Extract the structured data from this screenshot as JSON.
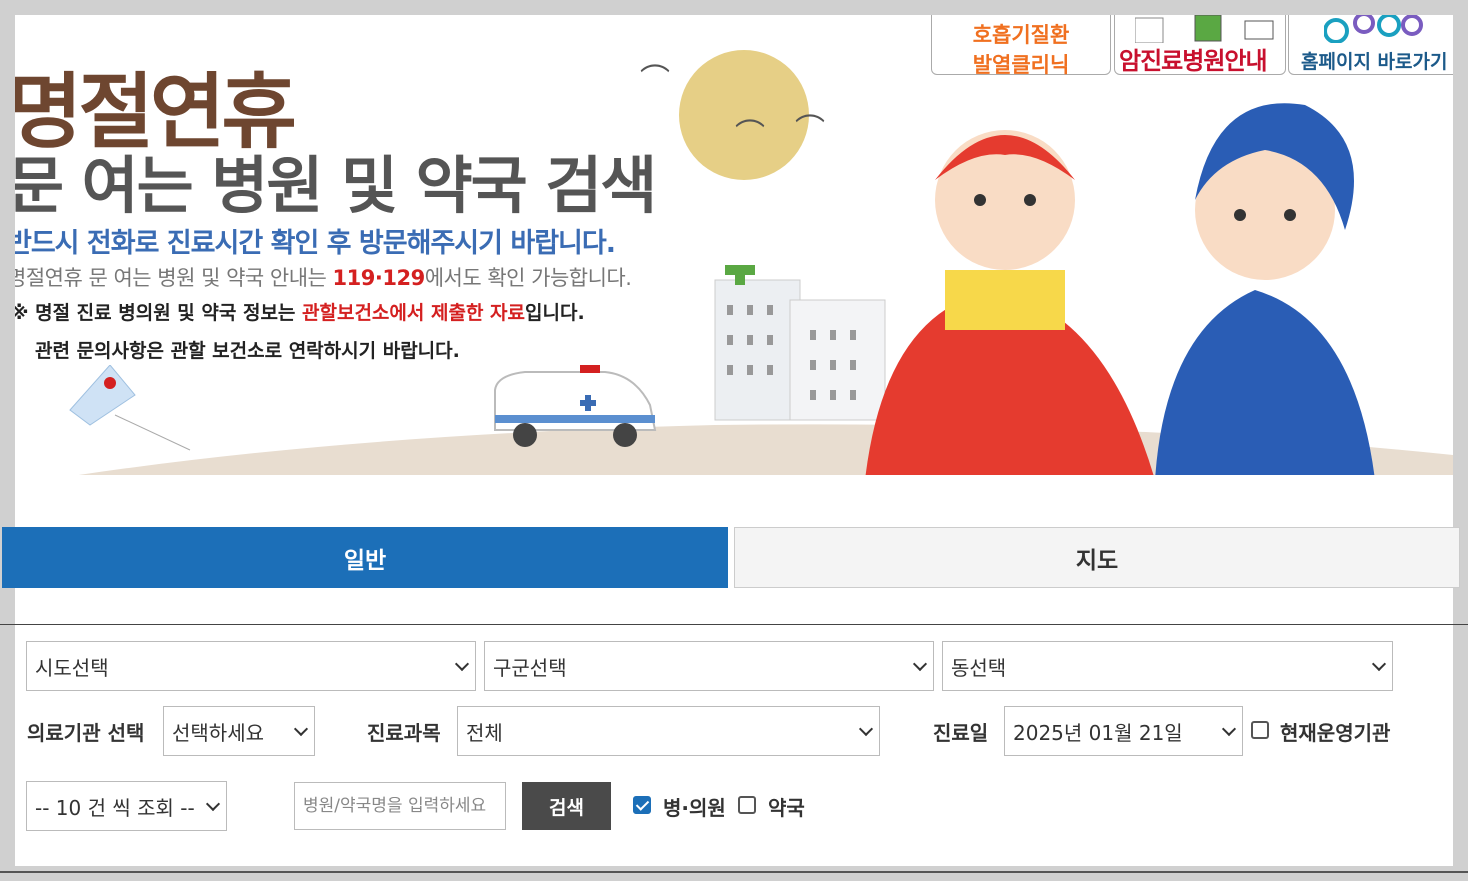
{
  "banner": {
    "title1": "명절연휴",
    "title2": "문 여는 병원 및 약국 검색",
    "line1": "반드시 전화로 진료시간 확인 후 방문해주시기 바랍니다.",
    "line2_a": "명절연휴 문 여는 병원 및 약국 안내는 ",
    "line2_num": "119·129",
    "line2_b": "에서도 확인 가능합니다.",
    "line3_a": "※ 명절 진료 병의원 및 약국 정보는 ",
    "line3_red": "관할보건소에서 제출한 자료",
    "line3_b": "입니다.",
    "line4": "관련 문의사항은 관할 보건소로 연락하시기 바랍니다."
  },
  "top_links": {
    "clinic_line1": "호흡기질환",
    "clinic_line2": "발열클리닉",
    "cancer": "암진료병원안내",
    "home": "홈페이지 바로가기"
  },
  "tabs": {
    "general": "일반",
    "map": "지도"
  },
  "filters": {
    "sido": "시도선택",
    "gugun": "구군선택",
    "dong": "동선택",
    "inst_label": "의료기관 선택",
    "inst_value": "선택하세요",
    "dept_label": "진료과목",
    "dept_value": "전체",
    "date_label": "진료일",
    "date_value": "2025년 01월 21일",
    "now_label": "현재운영기관",
    "count_value": "-- 10 건 씩 조회 --",
    "search_placeholder": "병원/약국명을 입력하세요",
    "search_button": "검색",
    "hosp_label": "병·의원",
    "pharm_label": "약국"
  },
  "colors": {
    "tab_active": "#1c6fb8",
    "search_button": "#4a4a4a",
    "title_brown": "#6e4630",
    "accent_red": "#d42020"
  }
}
